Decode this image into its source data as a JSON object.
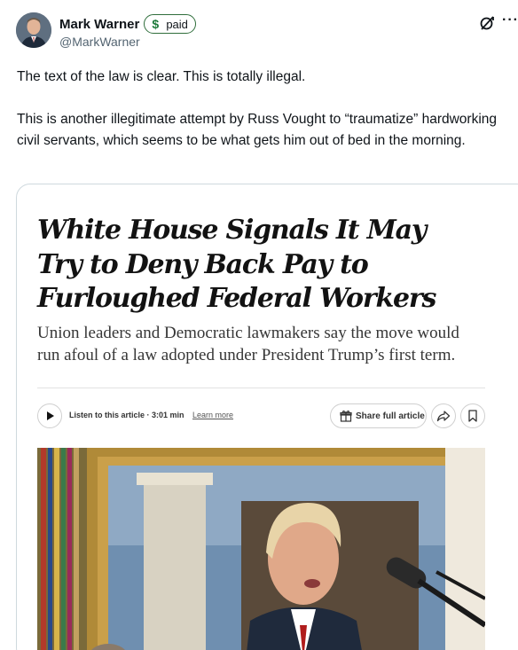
{
  "author": {
    "name": "Mark Warner",
    "badge_label": "paid",
    "badge_symbol": "$",
    "handle": "@MarkWarner"
  },
  "tweet": {
    "paragraphs": [
      "The text of the law is clear. This is totally illegal.",
      "This is another illegitimate attempt by Russ Vought to “traumatize” hardworking civil servants, which seems to be what gets him out of bed in the morning."
    ]
  },
  "card": {
    "headline": "White House Signals It May Try to Deny Back Pay to Furloughed Federal Workers",
    "subhead": "Union leaders and Democratic lawmakers say the move would run afoul of a law adopted under President Trump’s first term.",
    "audio_label": "Listen to this article · 3:01 min",
    "learn_more": "Learn more",
    "share_full_article": "Share full article"
  },
  "icons": {
    "grok": "grok-icon",
    "more": "more-icon",
    "play": "play-icon",
    "gift": "gift-icon",
    "share": "share-arrow-icon",
    "bookmark": "bookmark-icon"
  },
  "colors": {
    "text": "#0f1419",
    "muted": "#536471",
    "badge_border": "#2f6e3b",
    "card_border": "#cfd9de"
  }
}
